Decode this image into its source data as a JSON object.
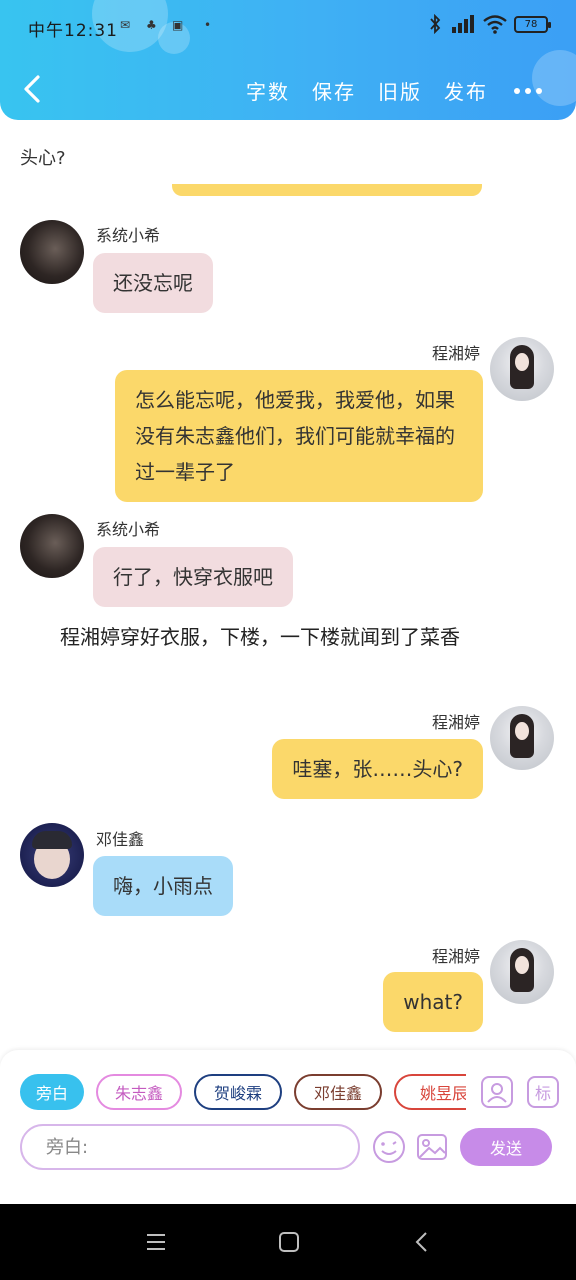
{
  "status_bar": {
    "time": "中午12:31",
    "battery": "78"
  },
  "header": {
    "toolbar": [
      "字数",
      "保存",
      "旧版",
      "发布"
    ]
  },
  "chat": {
    "top_text": "头心?",
    "messages": [
      {
        "sender": "系统小希",
        "text": "还没忘呢",
        "side": "left",
        "color": "pink",
        "avatar": "dark"
      },
      {
        "sender": "程湘婷",
        "text": "怎么能忘呢，他爱我，我爱他，如果没有朱志鑫他们，我们可能就幸福的过一辈子了",
        "side": "right",
        "color": "yellow",
        "avatar": "girl"
      },
      {
        "sender": "系统小希",
        "text": "行了，快穿衣服吧",
        "side": "left",
        "color": "pink",
        "avatar": "dark"
      },
      {
        "sender": "程湘婷",
        "text": "哇塞，张……头心?",
        "side": "right",
        "color": "yellow",
        "avatar": "girl"
      },
      {
        "sender": "邓佳鑫",
        "text": "嗨，小雨点",
        "side": "left",
        "color": "blue",
        "avatar": "boy"
      },
      {
        "sender": "程湘婷",
        "text": "what?",
        "side": "right",
        "color": "yellow",
        "avatar": "girl"
      }
    ],
    "narration": "程湘婷穿好衣服，下楼，一下楼就闻到了菜香"
  },
  "input_panel": {
    "characters": [
      "旁白",
      "朱志鑫",
      "贺峻霖",
      "邓佳鑫",
      "姚昱辰"
    ],
    "placeholder": "旁白:",
    "send_label": "发送",
    "tag_label": "标"
  }
}
